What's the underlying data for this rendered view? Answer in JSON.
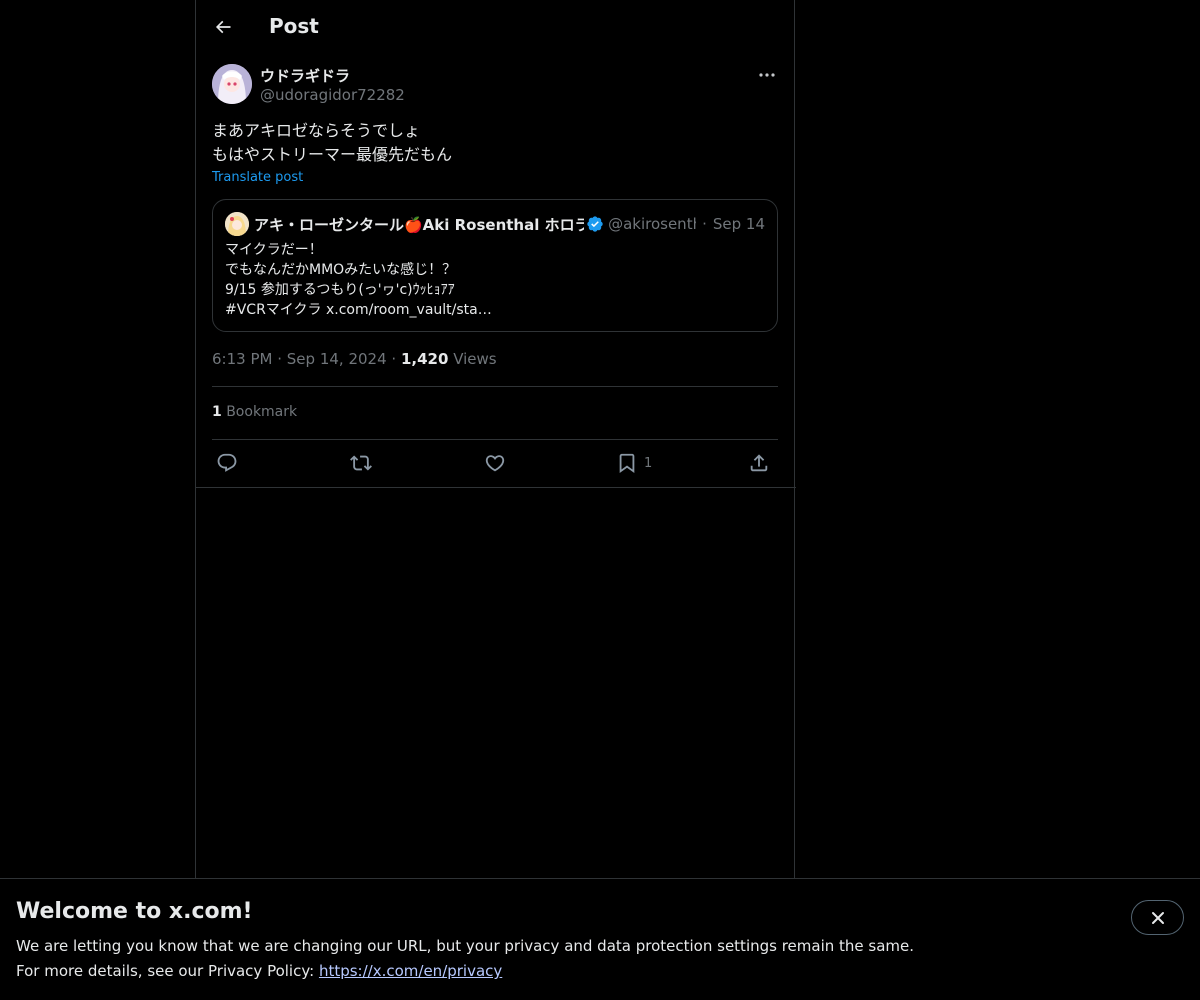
{
  "header": {
    "title": "Post",
    "back_icon": "arrow-left-icon"
  },
  "post": {
    "author_name": "ウドラギドラ",
    "author_handle": "@udoragidor72282",
    "text_lines": [
      "まあアキロゼならそうでしょ",
      "もはやストリーマー最優先だもん"
    ],
    "translate_label": "Translate post",
    "quoted": {
      "author_name": "アキ・ローゼンタール🍎Aki Rosenthal ホロライブ",
      "verified": true,
      "author_handle": "@akirosenthal",
      "date": "Sep 14",
      "text_lines": [
        "マイクラだー！",
        "でもなんだかMMOみたいな感じ！？",
        "9/15 参加するつもり(っ'ヮ'c)ｳｯﾋｮｱｱ",
        " #VCRマイクラ x.com/room_vault/sta…"
      ]
    },
    "time": "6:13 PM",
    "date": "Sep 14, 2024",
    "views_count": "1,420",
    "views_label": "Views",
    "bookmark_count": "1",
    "bookmark_label": "Bookmark",
    "actions": {
      "reply_icon": "reply-icon",
      "repost_icon": "repost-icon",
      "like_icon": "like-icon",
      "bookmark_icon": "bookmark-icon",
      "bookmark_count": "1",
      "share_icon": "share-icon"
    }
  },
  "banner": {
    "title": "Welcome to x.com!",
    "line1": "We are letting you know that we are changing our URL, but your privacy and data protection settings remain the same.",
    "line2_prefix": "For more details, see our Privacy Policy: ",
    "link": "https://x.com/en/privacy"
  },
  "colors": {
    "background": "#000000",
    "text": "#e7e9ea",
    "muted": "#71767b",
    "accent": "#1d9bf0",
    "border": "#2f3336"
  }
}
